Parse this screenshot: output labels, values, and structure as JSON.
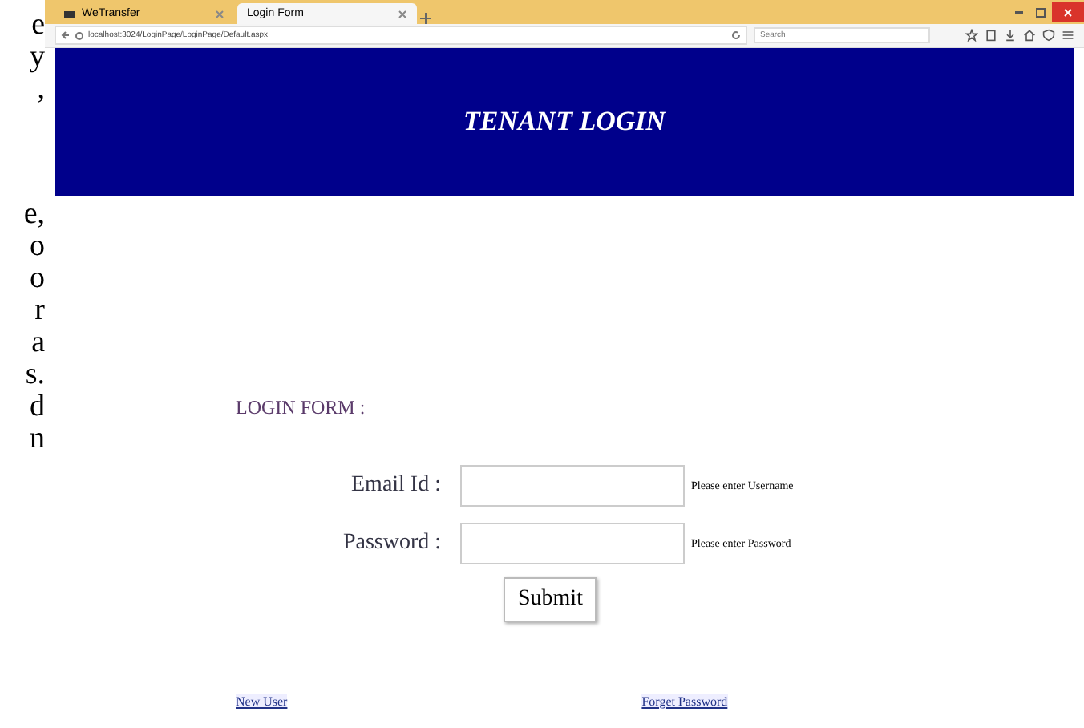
{
  "margin_text": [
    [
      "e",
      "y",
      ","
    ],
    [
      "e,",
      "o",
      "o",
      "r",
      "a",
      "s.",
      "d",
      "n"
    ]
  ],
  "tabs": [
    {
      "label": "WeTransfer",
      "selected": false
    },
    {
      "label": "Login Form",
      "selected": true
    }
  ],
  "address_bar": {
    "url": "localhost:3024/LoginPage/LoginPage/Default.aspx"
  },
  "search": {
    "placeholder": "Search"
  },
  "header": {
    "title": "TENANT LOGIN"
  },
  "form": {
    "heading": "LOGIN FORM :",
    "fields": [
      {
        "label": "Email Id :",
        "hint": "Please enter Username"
      },
      {
        "label": "Password :",
        "hint": "Please enter Password"
      }
    ],
    "submit": "Submit"
  },
  "links": [
    "New User",
    "Forget Password"
  ]
}
